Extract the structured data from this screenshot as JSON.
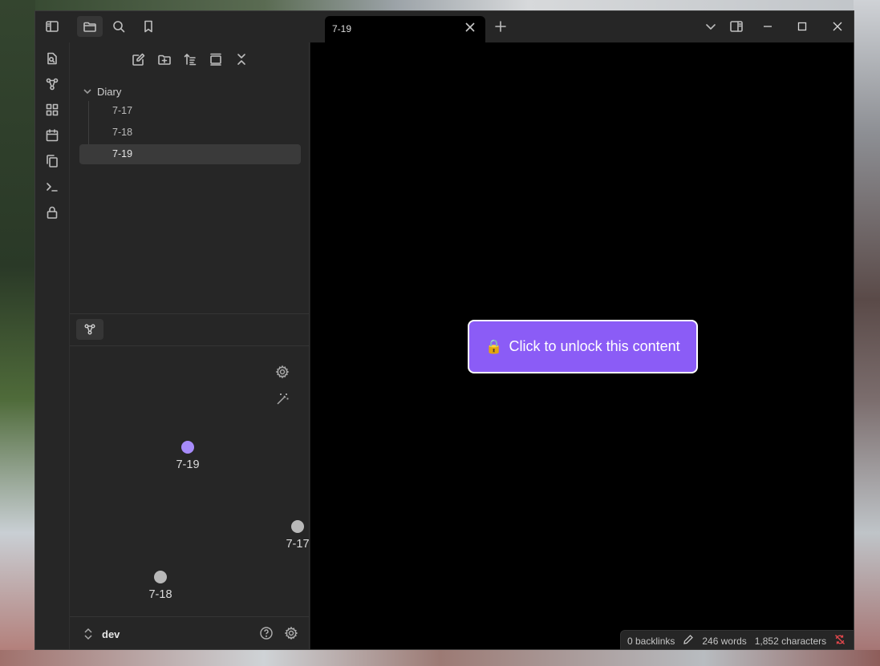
{
  "window": {
    "active_tab": "7-19"
  },
  "file_explorer": {
    "folder": "Diary",
    "files": [
      "7-17",
      "7-18",
      "7-19"
    ],
    "selected": "7-19"
  },
  "graph": {
    "nodes": [
      {
        "label": "7-19",
        "color": "#a78bfa",
        "active": true
      },
      {
        "label": "7-17",
        "color": "#b8b8b8",
        "active": false
      },
      {
        "label": "7-18",
        "color": "#b8b8b8",
        "active": false
      }
    ]
  },
  "vault": {
    "name": "dev"
  },
  "main": {
    "unlock_label": "Click to unlock this content",
    "unlock_icon": "🔒",
    "accent": "#8b5cf6"
  },
  "status": {
    "backlinks": "0 backlinks",
    "words": "246 words",
    "characters": "1,852 characters",
    "sync_icon_color": "#e5484d"
  },
  "icons": {
    "titlebar": [
      "sidebar-toggle-icon",
      "folder-icon",
      "search-icon",
      "bookmark-icon"
    ],
    "ribbon": [
      "file-search-icon",
      "graph-icon",
      "blocks-icon",
      "calendar-icon",
      "copy-icon",
      "terminal-icon",
      "lock-icon"
    ],
    "explorer_actions": [
      "new-note-icon",
      "new-folder-icon",
      "sort-icon",
      "collapse-view-icon",
      "collapse-all-icon"
    ]
  }
}
